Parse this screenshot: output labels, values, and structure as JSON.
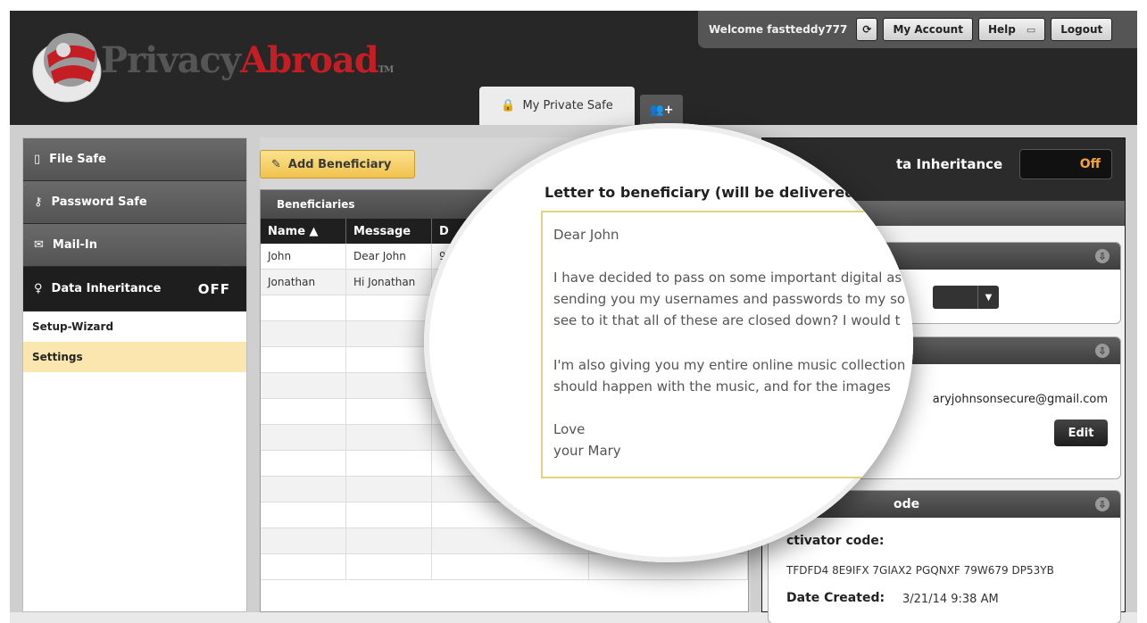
{
  "brand": {
    "name_part1": "Privacy",
    "name_part2": "Abroad",
    "tm": "TM",
    "colors": {
      "red": "#c41d24",
      "dark": "#272727"
    }
  },
  "userbar": {
    "welcome": "Welcome fastteddy777",
    "refresh_icon": "refresh-icon",
    "my_account": "My Account",
    "help": "Help",
    "logout": "Logout"
  },
  "tabs": {
    "main_label": "My Private Safe",
    "add_icon": "add-user-icon"
  },
  "sidebar": {
    "items": [
      {
        "label": "File Safe",
        "icon": "file-icon"
      },
      {
        "label": "Password Safe",
        "icon": "key-icon"
      },
      {
        "label": "Mail-In",
        "icon": "mail-icon"
      },
      {
        "label": "Data Inheritance",
        "icon": "bulb-icon",
        "status": "OFF"
      }
    ],
    "sub_items": [
      "Setup-Wizard",
      "Settings"
    ]
  },
  "beneficiaries": {
    "add_button": "Add Beneficiary",
    "title": "Beneficiaries",
    "columns": [
      "Name ▲",
      "Message",
      "D"
    ],
    "rows": [
      {
        "name": "John",
        "message": "Dear John",
        "date": "9/"
      },
      {
        "name": "Jonathan",
        "message": "Hi Jonathan",
        "date": "9/"
      }
    ]
  },
  "data_inheritance": {
    "title": "ta Inheritance",
    "toggle": "Off",
    "email": "aryjohnsonsecure@gmail.com",
    "edit_button": "Edit",
    "activator": {
      "header": "ode",
      "label": "ctivator code:",
      "code": "TFDFD4 8E9IFX 7GIAX2 PGQNXF 79W679 DP53YB",
      "date_label": "Date Created:",
      "date_value": "3/21/14 9:38 AM"
    }
  },
  "magnifier": {
    "title": "Letter to beneficiary (will be delivered wit...",
    "lines": [
      "Dear John",
      "I have decided to pass on some important digital as",
      "sending you my usernames and passwords to my so",
      "see to it that all of these are closed down? I would t",
      "I'm also giving you my entire online music collection",
      "should happen with the music, and for the images",
      "Love",
      "your Mary"
    ]
  }
}
